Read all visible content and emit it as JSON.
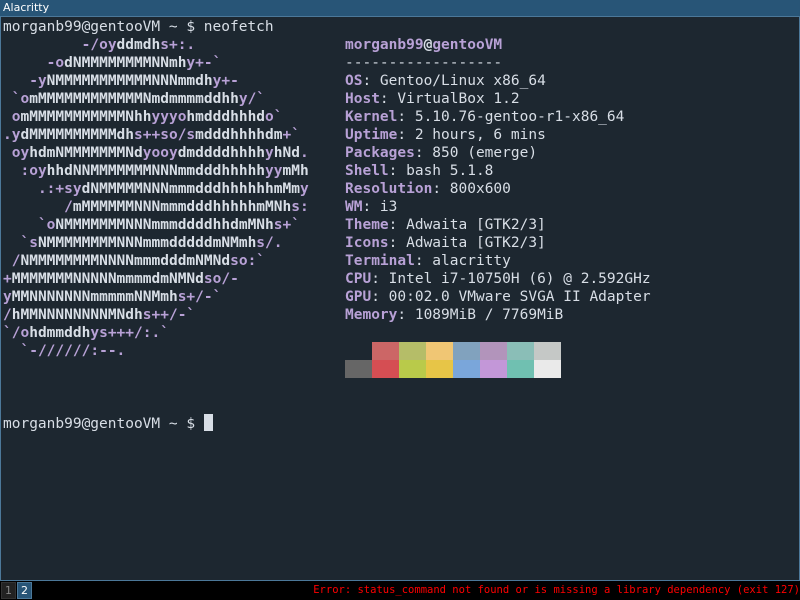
{
  "window": {
    "title": "Alacritty"
  },
  "terminal": {
    "command_line": "morganb99@gentooVM ~ $ neofetch",
    "prompt_line": "morganb99@gentooVM ~ $ ",
    "logo_lines": [
      "         -/oyddmdhs+:.",
      "     -odNMMMMMMMMNNmhy+-`",
      "   -yNMMMMMMMMMMMNNNmmdhy+-",
      " `omMMMMMMMMMMMMNmdmmmmddhhy/`",
      " omMMMMMMMMMMMNhhyyyohmdddhhhdo`",
      ".ydMMMMMMMMMMdhs++so/smdddhhhhdm+`",
      " oyhdmNMMMMMMMNdyooydmddddhhhhyhNd.",
      "  :oyhhdNNMMMMMMMNNNmmdddhhhhhyymMh",
      "    .:+sydNMMMMMNNNmmmdddhhhhhhmMmy",
      "       /mMMMMMMNNNmmmdddhhhhhmMNhs:",
      "    `oNMMMMMMMNNNmmmddddhhdmMNhs+`",
      "  `sNMMMMMMMMNNNmmmdddddmNMmhs/.",
      " /NMMMMMMMMNNNNmmmdddmNMNdso:`",
      "+MMMMMMMNNNNNmmmmdmNMNdso/-",
      "yMMNNNNNNNmmmmmNNMmhs+/-`",
      "/hMMNNNNNNNNMNdhs++/-`",
      "`/ohdmmddhys+++/:.`",
      "  `-//////:--."
    ],
    "info": {
      "user": "morganb99",
      "at": "@",
      "host": "gentooVM",
      "separator": "------------------",
      "rows": [
        {
          "key": "OS",
          "value": ": Gentoo/Linux x86_64"
        },
        {
          "key": "Host",
          "value": ": VirtualBox 1.2"
        },
        {
          "key": "Kernel",
          "value": ": 5.10.76-gentoo-r1-x86_64"
        },
        {
          "key": "Uptime",
          "value": ": 2 hours, 6 mins"
        },
        {
          "key": "Packages",
          "value": ": 850 (emerge)"
        },
        {
          "key": "Shell",
          "value": ": bash 5.1.8"
        },
        {
          "key": "Resolution",
          "value": ": 800x600"
        },
        {
          "key": "WM",
          "value": ": i3"
        },
        {
          "key": "Theme",
          "value": ": Adwaita [GTK2/3]"
        },
        {
          "key": "Icons",
          "value": ": Adwaita [GTK2/3]"
        },
        {
          "key": "Terminal",
          "value": ": alacritty"
        },
        {
          "key": "CPU",
          "value": ": Intel i7-10750H (6) @ 2.592GHz"
        },
        {
          "key": "GPU",
          "value": ": 00:02.0 VMware SVGA II Adapter"
        },
        {
          "key": "Memory",
          "value": ": 1089MiB / 7769MiB"
        }
      ]
    },
    "palette_top": [
      "#1d2730",
      "#cc6666",
      "#b5bd68",
      "#f0c674",
      "#81a2be",
      "#b294bb",
      "#8abeb7",
      "#c5c8c6"
    ],
    "palette_bottom": [
      "#666666",
      "#d54e53",
      "#b9ca4a",
      "#e7c547",
      "#7aa6da",
      "#c397d8",
      "#70c0b1",
      "#eaeaea"
    ]
  },
  "statusbar": {
    "workspaces": [
      "1",
      "2"
    ],
    "active_workspace": "2",
    "error": "Error: status_command not found or is missing a library dependency (exit 127)"
  }
}
